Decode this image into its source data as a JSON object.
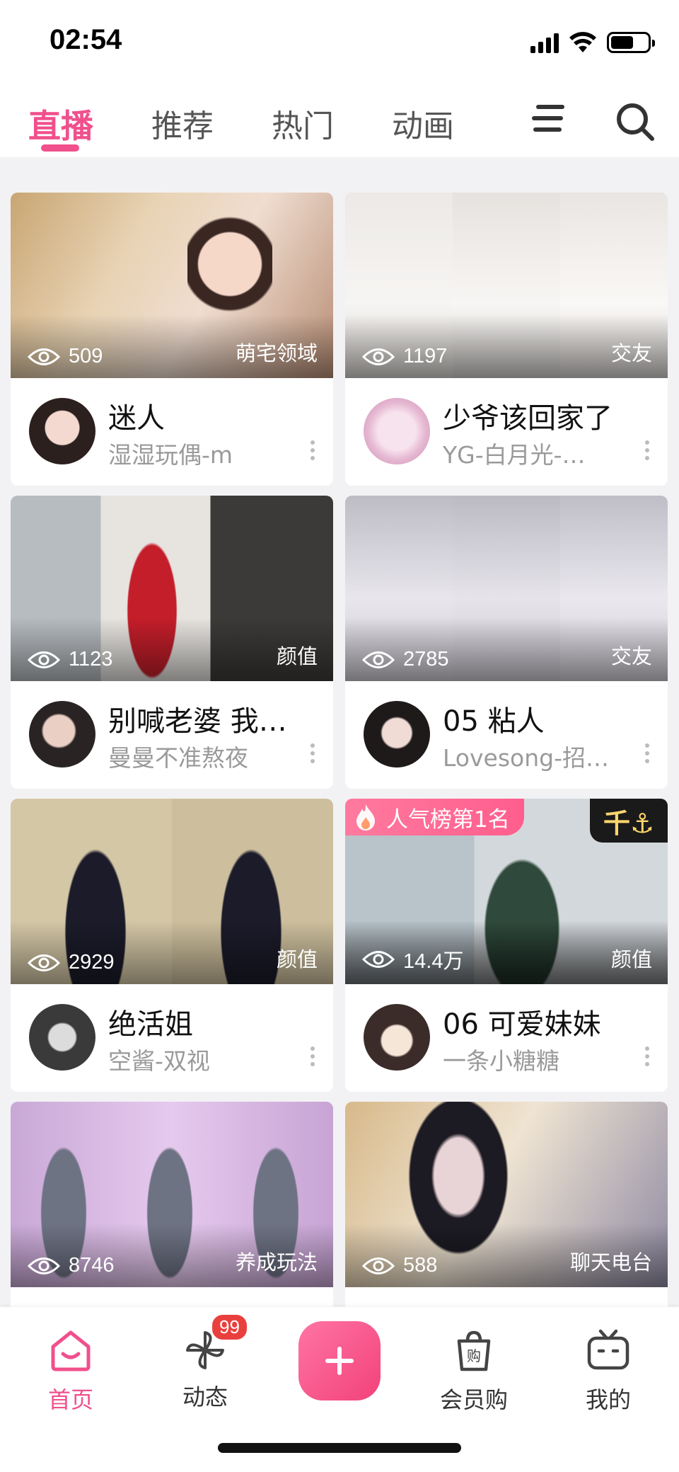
{
  "status_bar": {
    "time": "02:54"
  },
  "top_tabs": [
    {
      "label": "直播",
      "active": true
    },
    {
      "label": "推荐",
      "active": false
    },
    {
      "label": "热门",
      "active": false
    },
    {
      "label": "动画",
      "active": false
    }
  ],
  "accent_color": "#f0508c",
  "cards": [
    {
      "views": "509",
      "category": "萌宅领域",
      "title": "迷人",
      "subtitle": "湿湿玩偶-m"
    },
    {
      "views": "1197",
      "category": "交友",
      "title": "少爷该回家了",
      "subtitle": "YG-白月光-…"
    },
    {
      "views": "1123",
      "category": "颜值",
      "title": "别喊老婆 我…",
      "subtitle": "曼曼不准熬夜"
    },
    {
      "views": "2785",
      "category": "交友",
      "title": "05 粘人",
      "subtitle": "Lovesong-招…"
    },
    {
      "views": "2929",
      "category": "颜值",
      "title": "绝活姐",
      "subtitle": "空酱-双视"
    },
    {
      "views": "14.4万",
      "category": "颜值",
      "title": "06 可爱妹妹",
      "subtitle": "一条小糖糖",
      "hot_badge": "人气榜第1名",
      "rank_badge": "千⚓"
    },
    {
      "views": "8746",
      "category": "养成玩法",
      "title": "",
      "subtitle": ""
    },
    {
      "views": "588",
      "category": "聊天电台",
      "title": "",
      "subtitle": ""
    }
  ],
  "bottom_nav": {
    "home": "首页",
    "feed": "动态",
    "feed_badge": "99",
    "shop": "会员购",
    "me": "我的"
  }
}
